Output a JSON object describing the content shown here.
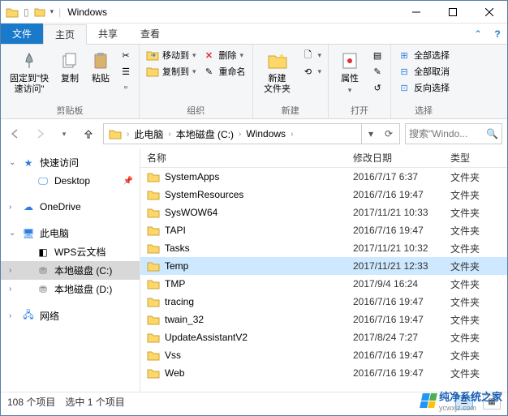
{
  "title": "Windows",
  "tabs": {
    "file": "文件",
    "home": "主页",
    "share": "共享",
    "view": "查看"
  },
  "ribbon": {
    "clipboard": {
      "pin": "固定到\"快\n速访问\"",
      "copy": "复制",
      "paste": "粘贴",
      "label": "剪贴板"
    },
    "organize": {
      "moveTo": "移动到",
      "copyTo": "复制到",
      "delete": "删除",
      "rename": "重命名",
      "label": "组织"
    },
    "new": {
      "newFolder": "新建\n文件夹",
      "label": "新建"
    },
    "open": {
      "properties": "属性",
      "label": "打开"
    },
    "select": {
      "selectAll": "全部选择",
      "selectNone": "全部取消",
      "invert": "反向选择",
      "label": "选择"
    }
  },
  "breadcrumb": [
    "此电脑",
    "本地磁盘 (C:)",
    "Windows"
  ],
  "search": {
    "placeholder": "搜索\"Windo..."
  },
  "nav": {
    "quickAccess": "快速访问",
    "desktop": "Desktop",
    "oneDrive": "OneDrive",
    "thisPC": "此电脑",
    "wpsCloud": "WPS云文档",
    "diskC": "本地磁盘 (C:)",
    "diskD": "本地磁盘 (D:)",
    "network": "网络"
  },
  "columns": {
    "name": "名称",
    "date": "修改日期",
    "type": "类型"
  },
  "folders": [
    {
      "name": "SystemApps",
      "date": "2016/7/17 6:37",
      "type": "文件夹",
      "selected": false
    },
    {
      "name": "SystemResources",
      "date": "2016/7/16 19:47",
      "type": "文件夹",
      "selected": false
    },
    {
      "name": "SysWOW64",
      "date": "2017/11/21 10:33",
      "type": "文件夹",
      "selected": false
    },
    {
      "name": "TAPI",
      "date": "2016/7/16 19:47",
      "type": "文件夹",
      "selected": false
    },
    {
      "name": "Tasks",
      "date": "2017/11/21 10:32",
      "type": "文件夹",
      "selected": false
    },
    {
      "name": "Temp",
      "date": "2017/11/21 12:33",
      "type": "文件夹",
      "selected": true
    },
    {
      "name": "TMP",
      "date": "2017/9/4 16:24",
      "type": "文件夹",
      "selected": false
    },
    {
      "name": "tracing",
      "date": "2016/7/16 19:47",
      "type": "文件夹",
      "selected": false
    },
    {
      "name": "twain_32",
      "date": "2016/7/16 19:47",
      "type": "文件夹",
      "selected": false
    },
    {
      "name": "UpdateAssistantV2",
      "date": "2017/8/24 7:27",
      "type": "文件夹",
      "selected": false
    },
    {
      "name": "Vss",
      "date": "2016/7/16 19:47",
      "type": "文件夹",
      "selected": false
    },
    {
      "name": "Web",
      "date": "2016/7/16 19:47",
      "type": "文件夹",
      "selected": false
    }
  ],
  "status": {
    "itemCount": "108 个项目",
    "selection": "选中 1 个项目"
  },
  "watermark": {
    "text": "纯净系统之家",
    "url": "ycwxjz.com"
  }
}
